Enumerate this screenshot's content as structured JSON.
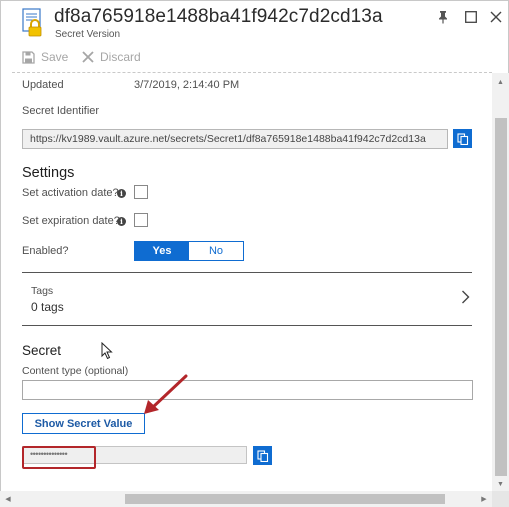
{
  "header": {
    "title": "df8a765918e1488ba41f942c7d2cd13a",
    "subtitle": "Secret Version",
    "icons": [
      "key-vault-lock-icon",
      "pin-icon",
      "maximize-icon",
      "close-icon"
    ]
  },
  "toolbar": {
    "save_label": "Save",
    "discard_label": "Discard"
  },
  "details": {
    "updated_label": "Updated",
    "updated_value": "3/7/2019, 2:14:40 PM",
    "identifier_label": "Secret Identifier",
    "identifier_value": "https://kv1989.vault.azure.net/secrets/Secret1/df8a765918e1488ba41f942c7d2cd13a"
  },
  "settings": {
    "heading": "Settings",
    "activation_label": "Set activation date?",
    "expiration_label": "Set expiration date?",
    "enabled_label": "Enabled?",
    "yes_label": "Yes",
    "no_label": "No",
    "enabled_selected": "Yes"
  },
  "tags": {
    "label": "Tags",
    "value": "0 tags"
  },
  "secret": {
    "heading": "Secret",
    "content_type_label": "Content type (optional)",
    "content_type_value": "",
    "show_button_label": "Show Secret Value",
    "masked_value": "••••••••••••••"
  },
  "colors": {
    "accent": "#0f6cd1",
    "annotation_red": "#b3262a"
  }
}
